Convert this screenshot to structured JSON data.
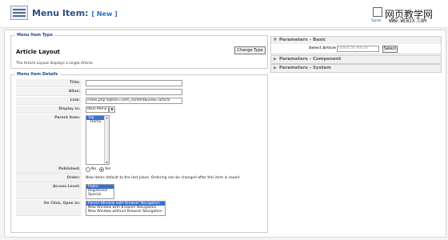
{
  "header": {
    "title": "Menu Item:",
    "subtitle": "[ New ]",
    "save_label": "Save"
  },
  "watermark": {
    "line1": "网页教学网",
    "line2": "WWW.WEBJX.COM"
  },
  "menu_item_type": {
    "legend": "Menu Item Type",
    "layout_title": "Article Layout",
    "description": "The Article Layout displays a single Article.",
    "change_type_button": "Change Type"
  },
  "details": {
    "legend": "Menu Item Details",
    "title_label": "Title:",
    "title_value": "",
    "alias_label": "Alias:",
    "alias_value": "",
    "link_label": "Link:",
    "link_value": "index.php?option=com_content&view=article",
    "display_in_label": "Display in:",
    "display_in_value": "Main Menu",
    "parent_item_label": "Parent Item:",
    "parent_items": [
      "Top",
      "Home"
    ],
    "published_label": "Published:",
    "published_no": "No",
    "published_yes": "Yes",
    "published_value": "Yes",
    "order_label": "Order:",
    "order_text": "New items default to the last place. Ordering can be changed after this item is saved.",
    "access_label": "Access Level:",
    "access_levels": [
      "Public",
      "Registered",
      "Special"
    ],
    "onclick_label": "On Click, Open in:",
    "onclick_options": [
      "Parent Window with Browser Navigation",
      "New Window with Browser Navigation",
      "New Window without Browser Navigation"
    ]
  },
  "params_basic": {
    "title": "Parameters - Basic",
    "select_article_label": "Select Article",
    "select_article_placeholder": "Select an Article",
    "select_button": "Select"
  },
  "params_component": {
    "title": "Parameters - Component"
  },
  "params_system": {
    "title": "Parameters - System"
  }
}
